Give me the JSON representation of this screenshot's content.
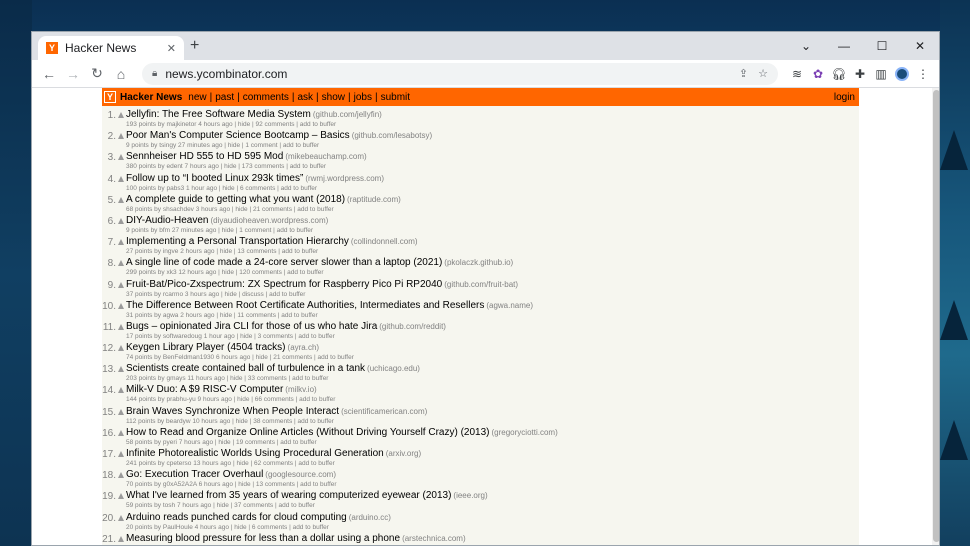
{
  "browser": {
    "tab_title": "Hacker News",
    "favicon_letter": "Y",
    "url": "news.ycombinator.com"
  },
  "hn": {
    "logo_letter": "Y",
    "site_name": "Hacker News",
    "nav": [
      "new",
      "past",
      "comments",
      "ask",
      "show",
      "jobs",
      "submit"
    ],
    "login": "login"
  },
  "stories": [
    {
      "rank": "1.",
      "title": "Jellyfin: The Free Software Media System",
      "site": "(github.com/jellyfin)",
      "sub": "193 points by majkinetor 4 hours ago | hide | 92 comments | add to buffer"
    },
    {
      "rank": "2.",
      "title": "Poor Man's Computer Science Bootcamp – Basics",
      "site": "(github.com/lesabotsy)",
      "sub": "9 points by tsingy 27 minutes ago | hide | 1 comment | add to buffer"
    },
    {
      "rank": "3.",
      "title": "Sennheiser HD 555 to HD 595 Mod",
      "site": "(mikebeauchamp.com)",
      "sub": "380 points by edent 7 hours ago | hide | 173 comments | add to buffer"
    },
    {
      "rank": "4.",
      "title": "Follow up to “I booted Linux 293k times”",
      "site": "(rwmj.wordpress.com)",
      "sub": "100 points by pabs3 1 hour ago | hide | 6 comments | add to buffer"
    },
    {
      "rank": "5.",
      "title": "A complete guide to getting what you want (2018)",
      "site": "(raptitude.com)",
      "sub": "68 points by shsachdev 3 hours ago | hide | 21 comments | add to buffer"
    },
    {
      "rank": "6.",
      "title": "DIY-Audio-Heaven",
      "site": "(diyaudioheaven.wordpress.com)",
      "sub": "9 points by bfm 27 minutes ago | hide | 1 comment | add to buffer"
    },
    {
      "rank": "7.",
      "title": "Implementing a Personal Transportation Hierarchy",
      "site": "(collindonnell.com)",
      "sub": "27 points by ingve 2 hours ago | hide | 13 comments | add to buffer"
    },
    {
      "rank": "8.",
      "title": "A single line of code made a 24-core server slower than a laptop (2021)",
      "site": "(pkolaczk.github.io)",
      "sub": "299 points by xk3 12 hours ago | hide | 120 comments | add to buffer"
    },
    {
      "rank": "9.",
      "title": "Fruit-Bat/Pico-Zxspectrum: ZX Spectrum for Raspberry Pico Pi RP2040",
      "site": "(github.com/fruit-bat)",
      "sub": "37 points by rcarmo 3 hours ago | hide | discuss | add to buffer"
    },
    {
      "rank": "10.",
      "title": "The Difference Between Root Certificate Authorities, Intermediates and Resellers",
      "site": "(agwa.name)",
      "sub": "31 points by agwa 2 hours ago | hide | 11 comments | add to buffer"
    },
    {
      "rank": "11.",
      "title": "Bugs – opinionated Jira CLI for those of us who hate Jira",
      "site": "(github.com/reddit)",
      "sub": "17 points by softwaredoug 1 hour ago | hide | 3 comments | add to buffer"
    },
    {
      "rank": "12.",
      "title": "Keygen Library Player (4504 tracks)",
      "site": "(ayra.ch)",
      "sub": "74 points by BenFeldman1930 6 hours ago | hide | 21 comments | add to buffer"
    },
    {
      "rank": "13.",
      "title": "Scientists create contained ball of turbulence in a tank",
      "site": "(uchicago.edu)",
      "sub": "203 points by gmays 11 hours ago | hide | 33 comments | add to buffer"
    },
    {
      "rank": "14.",
      "title": "Milk-V Duo: A $9 RISC-V Computer",
      "site": "(milkv.io)",
      "sub": "144 points by prabhu-yu 9 hours ago | hide | 66 comments | add to buffer"
    },
    {
      "rank": "15.",
      "title": "Brain Waves Synchronize When People Interact",
      "site": "(scientificamerican.com)",
      "sub": "112 points by beardyw 10 hours ago | hide | 38 comments | add to buffer"
    },
    {
      "rank": "16.",
      "title": "How to Read and Organize Online Articles (Without Driving Yourself Crazy) (2013)",
      "site": "(gregoryciotti.com)",
      "sub": "58 points by pyeri 7 hours ago | hide | 19 comments | add to buffer"
    },
    {
      "rank": "17.",
      "title": "Infinite Photorealistic Worlds Using Procedural Generation",
      "site": "(arxiv.org)",
      "sub": "241 points by cpeterso 13 hours ago | hide | 62 comments | add to buffer"
    },
    {
      "rank": "18.",
      "title": "Go: Execution Tracer Overhaul",
      "site": "(googlesource.com)",
      "sub": "70 points by g0xA52A2A 6 hours ago | hide | 13 comments | add to buffer"
    },
    {
      "rank": "19.",
      "title": "What I've learned from 35 years of wearing computerized eyewear (2013)",
      "site": "(ieee.org)",
      "sub": "59 points by tosh 7 hours ago | hide | 37 comments | add to buffer"
    },
    {
      "rank": "20.",
      "title": "Arduino reads punched cards for cloud computing",
      "site": "(arduino.cc)",
      "sub": "20 points by PaulHoule 4 hours ago | hide | 6 comments | add to buffer"
    },
    {
      "rank": "21.",
      "title": "Measuring blood pressure for less than a dollar using a phone",
      "site": "(arstechnica.com)",
      "sub": "171 points by rumbly 14 hours ago | hide | 65 comments | add to buffer"
    }
  ],
  "colors": {
    "hn_orange": "#ff6600",
    "hn_bg": "#f6f6ef",
    "subtext": "#828282"
  }
}
